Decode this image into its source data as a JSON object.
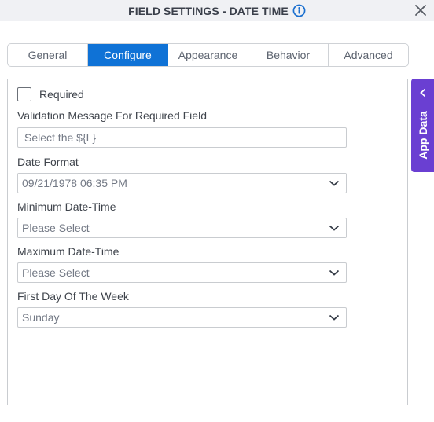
{
  "header": {
    "title": "FIELD SETTINGS - DATE TIME",
    "info_icon": "info-circle-icon",
    "close_icon": "close-x-icon"
  },
  "tabs": [
    {
      "label": "General",
      "active": false
    },
    {
      "label": "Configure",
      "active": true
    },
    {
      "label": "Appearance",
      "active": false
    },
    {
      "label": "Behavior",
      "active": false
    },
    {
      "label": "Advanced",
      "active": false
    }
  ],
  "configure": {
    "required": {
      "label": "Required",
      "checked": false
    },
    "validation_message": {
      "label": "Validation Message For Required Field",
      "value": "Select the ${L}"
    },
    "date_format": {
      "label": "Date Format",
      "selected": "09/21/1978 06:35 PM"
    },
    "minimum_date_time": {
      "label": "Minimum Date-Time",
      "selected": "Please Select"
    },
    "maximum_date_time": {
      "label": "Maximum Date-Time",
      "selected": "Please Select"
    },
    "first_day_of_week": {
      "label": "First Day Of The Week",
      "selected": "Sunday"
    }
  },
  "side_panel": {
    "label": "App Data",
    "icon": "chevron-left-icon"
  },
  "colors": {
    "accent": "#0f72d6",
    "app_data": "#6a3fd2",
    "header_bg": "#f0f1f4",
    "info_icon": "#1a6fcf"
  }
}
